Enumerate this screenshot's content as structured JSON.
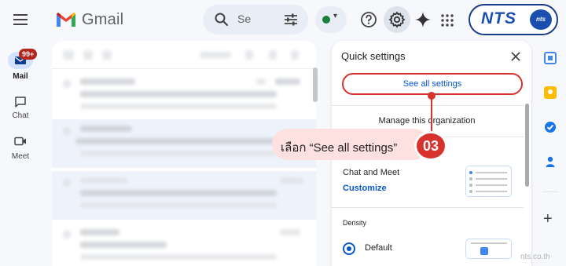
{
  "header": {
    "app_name": "Gmail",
    "search_placeholder": "Se",
    "brand_text": "NTS",
    "brand_badge": "nts"
  },
  "rail": {
    "mail_label": "Mail",
    "mail_badge": "99+",
    "chat_label": "Chat",
    "meet_label": "Meet"
  },
  "quick_settings": {
    "title": "Quick settings",
    "see_all_label": "See all settings",
    "manage_label": "Manage this organization",
    "chat_meet_label": "Chat and Meet",
    "customize_label": "Customize",
    "density_label": "Density",
    "density_default": "Default"
  },
  "callout": {
    "text": "เลือก “See all settings”",
    "step": "03"
  },
  "watermark": "nts.co.th",
  "colors": {
    "accent_red": "#d8322f",
    "link_blue": "#0b57d0",
    "status_green": "#188038"
  }
}
